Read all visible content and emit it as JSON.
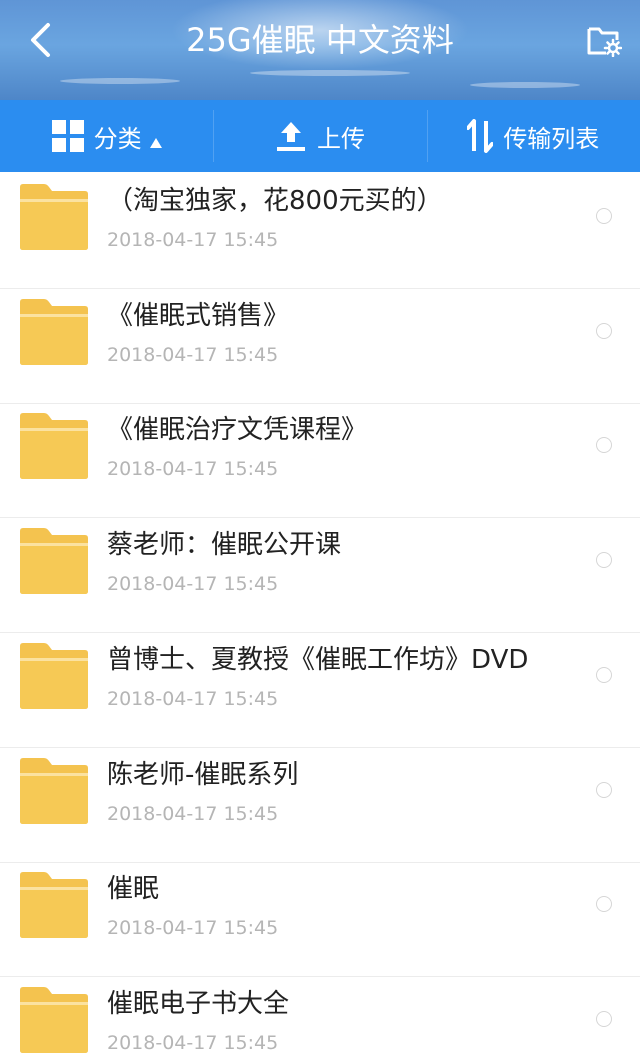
{
  "header": {
    "title": "25G催眠 中文资料",
    "back_icon": "chevron-left-icon",
    "new_folder_icon": "folder-settings-icon"
  },
  "toolbar": {
    "category_label": "分类",
    "upload_label": "上传",
    "transfer_label": "传输列表"
  },
  "colors": {
    "toolbar_bg": "#2b8df0",
    "folder": "#f4c34f",
    "date_text": "#b5b5b5"
  },
  "files": [
    {
      "name": "（淘宝独家，花800元买的）",
      "date": "2018-04-17  15:45"
    },
    {
      "name": "《催眠式销售》",
      "date": "2018-04-17  15:45"
    },
    {
      "name": "《催眠治疗文凭课程》",
      "date": "2018-04-17  15:45"
    },
    {
      "name": "蔡老师：催眠公开课",
      "date": "2018-04-17  15:45"
    },
    {
      "name": "曾博士、夏教授《催眠工作坊》DVD",
      "date": "2018-04-17  15:45"
    },
    {
      "name": "陈老师-催眠系列",
      "date": "2018-04-17  15:45"
    },
    {
      "name": "催眠",
      "date": "2018-04-17  15:45"
    },
    {
      "name": "催眠电子书大全",
      "date": "2018-04-17  15:45"
    }
  ]
}
